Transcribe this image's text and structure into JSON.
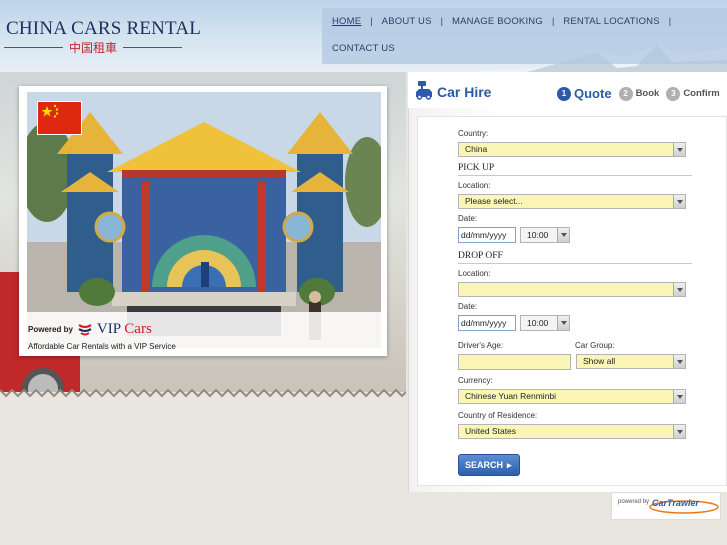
{
  "brand": {
    "title": "CHINA CARS RENTAL",
    "subtitle_cn": "中国租車"
  },
  "nav": {
    "items": [
      {
        "label": "HOME",
        "active": true
      },
      {
        "label": "ABOUT US"
      },
      {
        "label": "MANAGE BOOKING"
      },
      {
        "label": "RENTAL LOCATIONS"
      },
      {
        "label": "CONTACT US"
      }
    ],
    "separator": "|"
  },
  "promo": {
    "flag": "china-flag",
    "powered_by": "Powered by",
    "vip_brand_a": "VIP",
    "vip_brand_b": "Cars",
    "tagline": "Affordable Car Rentals with a VIP Service"
  },
  "panel": {
    "title": "Car Hire",
    "steps": [
      {
        "num": "1",
        "label": "Quote",
        "active": true
      },
      {
        "num": "2",
        "label": "Book"
      },
      {
        "num": "3",
        "label": "Confirm"
      }
    ]
  },
  "form": {
    "country_label": "Country:",
    "country_value": "China",
    "pickup_heading": "PICK UP",
    "pickup_location_label": "Location:",
    "pickup_location_value": "Please select...",
    "pickup_date_label": "Date:",
    "pickup_date_value": "dd/mm/yyyy",
    "pickup_time_value": "10:00",
    "dropoff_heading": "DROP OFF",
    "dropoff_location_label": "Location:",
    "dropoff_location_value": "",
    "dropoff_date_label": "Date:",
    "dropoff_date_value": "dd/mm/yyyy",
    "dropoff_time_value": "10:00",
    "driver_age_label": "Driver's Age:",
    "driver_age_value": "",
    "car_group_label": "Car Group:",
    "car_group_value": "Show all",
    "currency_label": "Currency:",
    "currency_value": "Chinese Yuan Renminbi",
    "residence_label": "Country of Residence:",
    "residence_value": "United States",
    "search_label": "SEARCH"
  },
  "footer": {
    "powered_by": "powered by",
    "partner": "CarTrawler"
  }
}
